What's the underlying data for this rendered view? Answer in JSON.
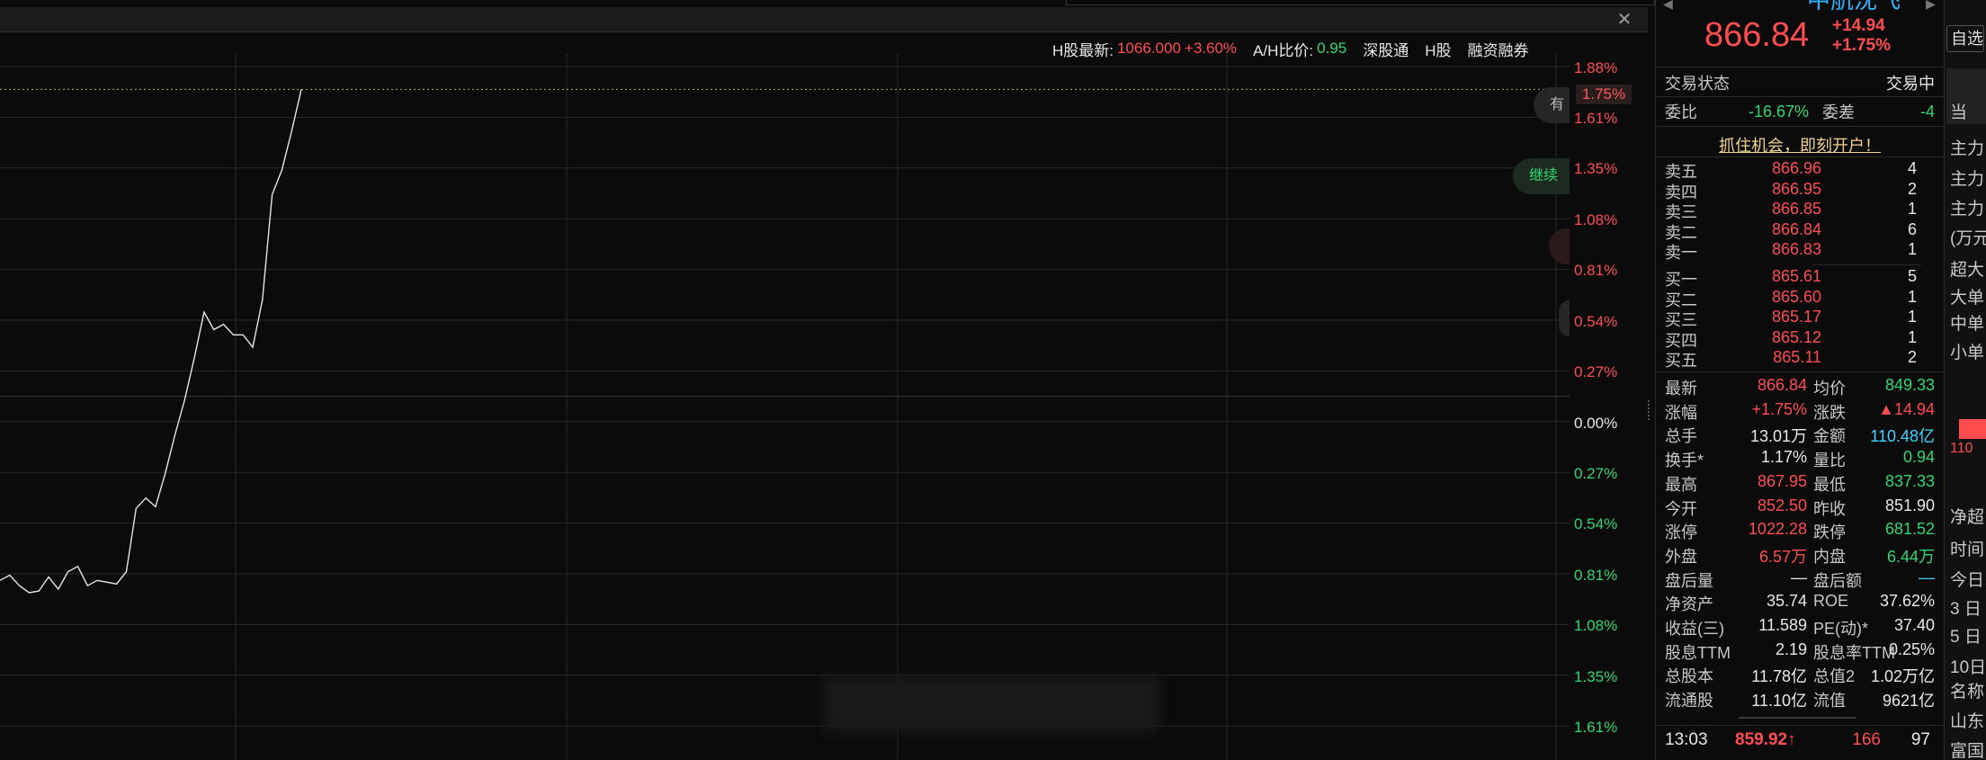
{
  "header": {
    "hk_label": "H股最新:",
    "hk_price": "1066.000",
    "hk_change": "+3.60%",
    "ah_label": "A/H比价:",
    "ah_value": "0.95",
    "links": [
      "深股通",
      "H股",
      "融资融券"
    ],
    "close_icon": "close-icon"
  },
  "chart": {
    "pct_axis_up": [
      "1.88%",
      "1.61%",
      "1.35%",
      "1.08%",
      "0.81%",
      "0.54%",
      "0.27%"
    ],
    "pct_axis_zero": "0.00%",
    "pct_axis_down": [
      "0.27%",
      "0.54%",
      "0.81%",
      "1.08%",
      "1.35%",
      "1.61%"
    ],
    "current_pct": "1.75%",
    "float_buttons": [
      "有",
      "继续"
    ],
    "colors": {
      "up": "#ff4d4f",
      "down": "#2fd870",
      "line": "#e6e6e6",
      "grid": "#2a2a2a"
    }
  },
  "chart_data": {
    "type": "line",
    "title": "",
    "xlabel": "",
    "ylabel": "",
    "ylim": [
      -1.88,
      1.88
    ],
    "x": [
      0,
      1,
      2,
      3,
      4,
      5,
      6,
      7,
      8,
      9,
      10,
      11,
      12,
      13,
      14,
      15,
      16,
      17,
      18,
      19,
      20,
      21,
      22,
      23,
      24,
      25,
      26,
      27,
      28,
      29,
      30,
      31,
      32,
      33,
      34,
      35
    ],
    "series": [
      {
        "values": [
          -1.05,
          -1.02,
          -1.08,
          -1.12,
          -1.11,
          -1.03,
          -1.1,
          -1.0,
          -0.97,
          -1.08,
          -1.05,
          -1.06,
          -1.07,
          -1.0,
          -0.64,
          -0.58,
          -0.63,
          -0.44,
          -0.22,
          -0.02,
          0.22,
          0.48,
          0.38,
          0.41,
          0.35,
          0.35,
          0.28,
          0.55,
          1.15,
          1.29,
          1.51,
          1.75,
          1.75,
          1.75,
          1.75,
          1.75
        ]
      }
    ]
  },
  "quote": {
    "name": "中航沈飞",
    "last_price": "866.84",
    "change_abs": "+14.94",
    "change_pct": "+1.75%",
    "status_label": "交易状态",
    "status_value": "交易中",
    "wei_bi_label": "委比",
    "wei_bi_value": "-16.67%",
    "wei_cha_label": "委差",
    "wei_cha_value": "-4",
    "promo": "抓住机会，即刻开户！",
    "asks": [
      {
        "label": "卖五",
        "price": "866.96",
        "vol": "4"
      },
      {
        "label": "卖四",
        "price": "866.95",
        "vol": "2"
      },
      {
        "label": "卖三",
        "price": "866.85",
        "vol": "1"
      },
      {
        "label": "卖二",
        "price": "866.84",
        "vol": "6"
      },
      {
        "label": "卖一",
        "price": "866.83",
        "vol": "1"
      }
    ],
    "bids": [
      {
        "label": "买一",
        "price": "865.61",
        "vol": "5"
      },
      {
        "label": "买二",
        "price": "865.60",
        "vol": "1"
      },
      {
        "label": "买三",
        "price": "865.17",
        "vol": "1"
      },
      {
        "label": "买四",
        "price": "865.12",
        "vol": "1"
      },
      {
        "label": "买五",
        "price": "865.11",
        "vol": "2"
      }
    ],
    "stats": [
      {
        "l1": "最新",
        "v1": "866.84",
        "c1": "red",
        "l2": "均价",
        "v2": "849.33",
        "c2": "green"
      },
      {
        "l1": "涨幅",
        "v1": "+1.75%",
        "c1": "red",
        "l2": "涨跌",
        "v2": "▲14.94",
        "c2": "red"
      },
      {
        "l1": "总手",
        "v1": "13.01万",
        "c1": "white",
        "l2": "金额",
        "v2": "110.48亿",
        "c2": "cyan"
      },
      {
        "l1": "换手*",
        "v1": "1.17%",
        "c1": "white",
        "l2": "量比",
        "v2": "0.94",
        "c2": "green"
      },
      {
        "l1": "最高",
        "v1": "867.95",
        "c1": "red",
        "l2": "最低",
        "v2": "837.33",
        "c2": "green"
      },
      {
        "l1": "今开",
        "v1": "852.50",
        "c1": "red",
        "l2": "昨收",
        "v2": "851.90",
        "c2": "white"
      },
      {
        "l1": "涨停",
        "v1": "1022.28",
        "c1": "red",
        "l2": "跌停",
        "v2": "681.52",
        "c2": "green"
      },
      {
        "l1": "外盘",
        "v1": "6.57万",
        "c1": "red",
        "l2": "内盘",
        "v2": "6.44万",
        "c2": "green"
      },
      {
        "l1": "盘后量",
        "v1": "—",
        "c1": "white",
        "l2": "盘后额",
        "v2": "—",
        "c2": "cyan"
      },
      {
        "l1": "净资产",
        "v1": "35.74",
        "c1": "white",
        "l2": "ROE",
        "v2": "37.62%",
        "c2": "white"
      },
      {
        "l1": "收益(三)",
        "v1": "11.589",
        "c1": "white",
        "l2": "PE(动)*",
        "v2": "37.40",
        "c2": "white"
      },
      {
        "l1": "股息TTM",
        "v1": "2.19",
        "c1": "white",
        "l2": "股息率TTM",
        "v2": "0.25%",
        "c2": "white"
      },
      {
        "l1": "总股本",
        "v1": "11.78亿",
        "c1": "white",
        "l2": "总值2",
        "v2": "1.02万亿",
        "c2": "white"
      },
      {
        "l1": "流通股",
        "v1": "11.10亿",
        "c1": "white",
        "l2": "流值",
        "v2": "9621亿",
        "c2": "white"
      }
    ],
    "tick": {
      "time": "13:03",
      "price": "859.92↑",
      "vol": "166",
      "count": "97"
    }
  },
  "side": {
    "top_button": "自选",
    "items": [
      "当",
      "主力",
      "主力",
      "主力",
      "(万元",
      "超大",
      "大单",
      "中单",
      "小单",
      "110",
      "净超",
      "时间",
      "今日",
      "3 日",
      "5 日",
      "10日",
      "名称",
      "山东",
      "富国"
    ]
  }
}
